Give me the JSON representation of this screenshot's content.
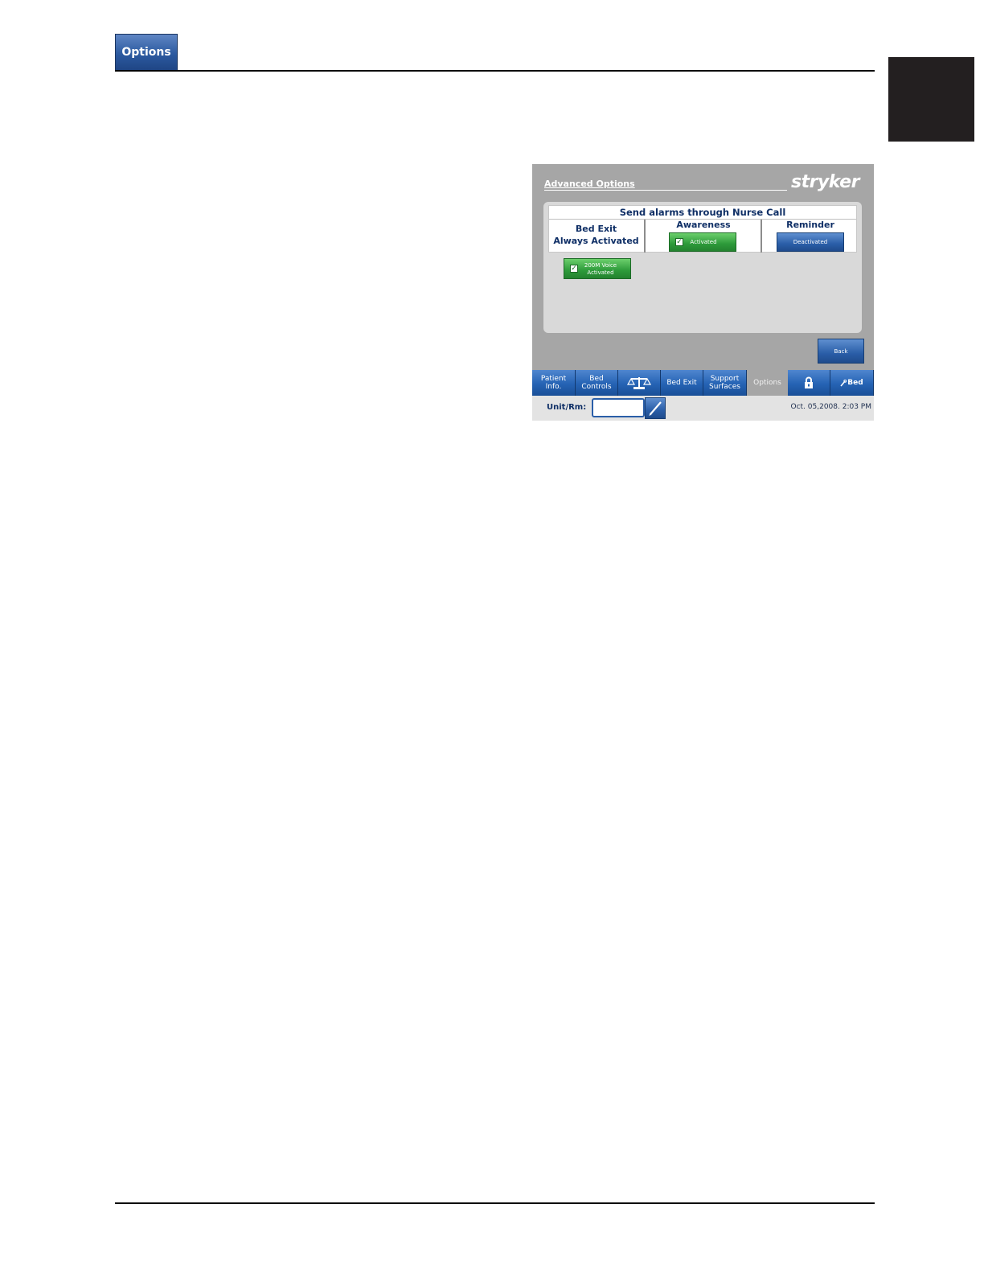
{
  "page": {
    "section_tab": "Options"
  },
  "screen": {
    "title": "Advanced Options",
    "brand": "stryker",
    "nurse_call": {
      "title": "Send alarms through Nurse Call",
      "bed_exit_line1": "Bed Exit",
      "bed_exit_line2": "Always Activated",
      "awareness": {
        "heading": "Awareness",
        "button": "Activated",
        "checked": true
      },
      "reminder": {
        "heading": "Reminder",
        "button": "Deactivated",
        "checked": false
      }
    },
    "voice_toggle": {
      "line1": "200M Voice",
      "line2": "Activated",
      "checked": true
    },
    "back_button": "Back",
    "tabs": [
      {
        "label1": "Patient",
        "label2": "Info."
      },
      {
        "label1": "Bed",
        "label2": "Controls"
      },
      {
        "icon": "scale-icon"
      },
      {
        "label1": "Bed Exit"
      },
      {
        "label1": "Support",
        "label2": "Surfaces"
      },
      {
        "label1": "Options",
        "selected": true
      },
      {
        "icon": "lock-icon"
      },
      {
        "label1": "Bed",
        "icon": "bed-wrench-icon"
      }
    ],
    "unit_rm_label": "Unit/Rm:",
    "unit_rm_value": "",
    "datetime": "Oct. 05,2008. 2:03 PM"
  }
}
